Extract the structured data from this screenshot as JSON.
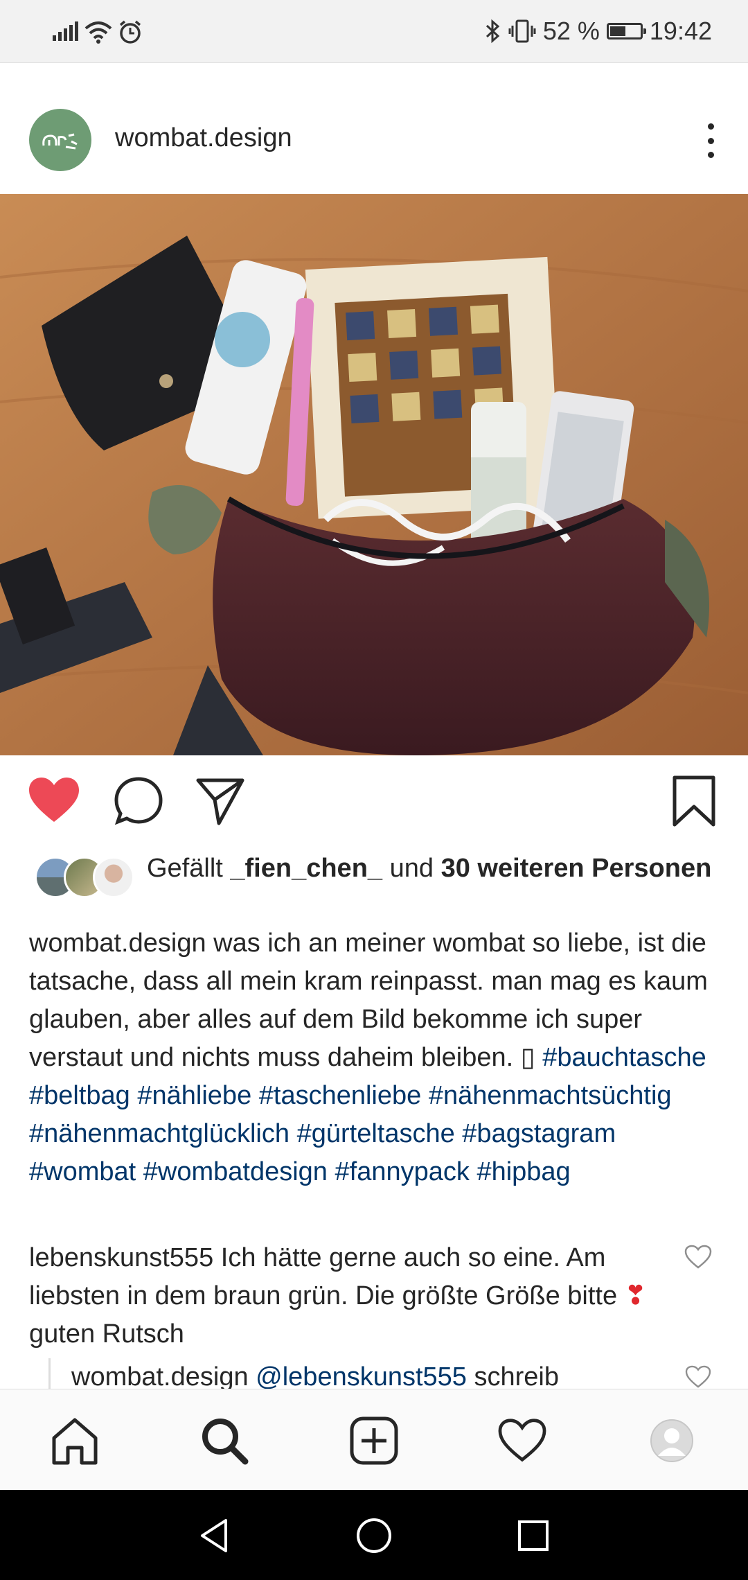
{
  "status_bar": {
    "battery_percent": "52 %",
    "time": "19:42",
    "battery_level": 0.52
  },
  "post": {
    "username": "wombat.design",
    "image_alt_icon": "photo"
  },
  "likes": {
    "prefix": "Gefällt ",
    "user": "_fien_chen_",
    "middle": " und ",
    "others": "30 weiteren Personen"
  },
  "caption": {
    "username": "wombat.design",
    "text": " was ich an meiner wombat so liebe, ist die tatsache, dass all mein kram reinpasst. man mag es kaum glauben, aber alles auf dem Bild bekomme ich super verstaut und nichts muss daheim bleiben. ▯ ",
    "hashtags": [
      "#bauchtasche",
      "#beltbag",
      "#nähliebe",
      "#taschenliebe",
      "#nähenmachtsüchtig",
      "#nähenmachtglücklich",
      "#gürteltasche",
      "#bagstagram",
      "#wombat",
      "#wombatdesign",
      "#fannypack",
      "#hipbag"
    ]
  },
  "comment": {
    "username": "lebenskunst555",
    "text_before": " Ich hätte gerne auch so eine. Am liebsten in dem braun grün. Die größte Größe bitte ",
    "emoji": "❣",
    "text_after": "guten Rutsch"
  },
  "reply": {
    "username": "wombat.design",
    "mention": "@lebenskunst555",
    "text": " schreib"
  },
  "colors": {
    "like_red": "#ed4956",
    "hashtag_blue": "#003569",
    "avatar_green": "#6e9c74"
  },
  "icons": {
    "like": "heart-filled-icon",
    "comment": "comment-bubble-icon",
    "share": "paper-plane-icon",
    "save": "bookmark-icon",
    "home": "home-icon",
    "search": "search-icon",
    "add": "add-post-icon",
    "activity": "heart-outline-icon",
    "profile": "profile-avatar-icon"
  }
}
